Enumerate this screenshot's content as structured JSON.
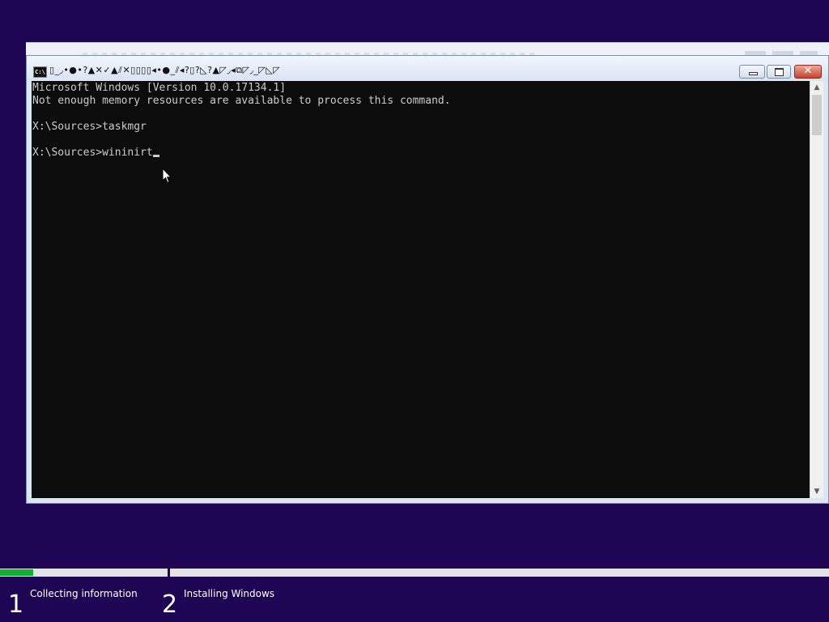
{
  "console": {
    "title": "▯_◞•●•?▲✕✓▲⫽✕▯▯▯▯◂•●_⫽◂?▯?◺?▲◸◞◂⧉◸◞_◸◺◸",
    "icon_text": "C:\\",
    "lines": [
      "Microsoft Windows [Version 10.0.17134.1]",
      "Not enough memory resources are available to process this command.",
      "",
      "X:\\Sources>taskmgr",
      "",
      "X:\\Sources>wininirt"
    ],
    "scroll_up": "▲",
    "scroll_down": "▼",
    "close_glyph": "✕"
  },
  "setup_progress": {
    "fill_fraction": 0.04,
    "steps": [
      {
        "number": "1",
        "label": "Collecting information"
      },
      {
        "number": "2",
        "label": "Installing Windows"
      }
    ]
  },
  "colors": {
    "desktop": "#1e0654",
    "console_bg": "#0c0c0c",
    "console_text": "#cccccc",
    "progress_fill": "#10b02e"
  }
}
